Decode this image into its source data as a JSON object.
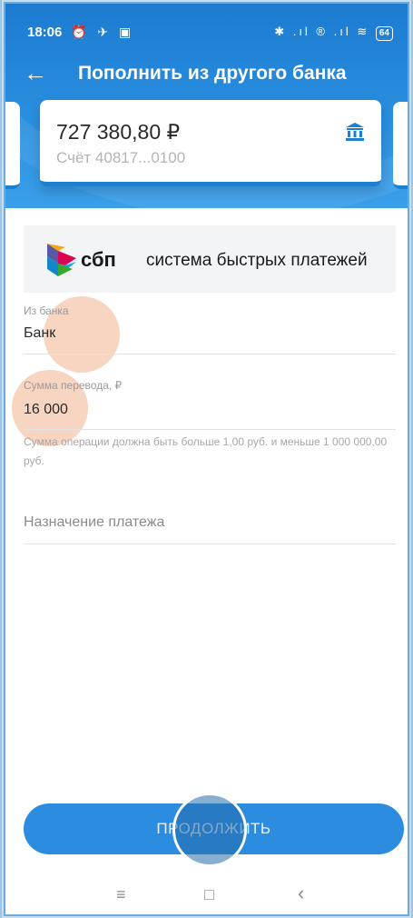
{
  "status_bar": {
    "time": "18:06",
    "left_icons": "⏰ ✈ ▣",
    "right_icons": "✱ .ıl ® .ıl ≋",
    "battery": "64"
  },
  "header": {
    "title": "Пополнить из другого банка"
  },
  "account": {
    "balance": "727 380,80 ₽",
    "number": "Счёт 40817...0100"
  },
  "sbp": {
    "short": "сбп",
    "long": "система быстрых платежей"
  },
  "form": {
    "bank_label": "Из банка",
    "bank_value": "Банк",
    "amount_label": "Сумма перевода, ₽",
    "amount_value": "16 000",
    "amount_hint": "Сумма операции должна быть больше 1,00 руб. и меньше 1 000 000,00 руб.",
    "purpose_placeholder": "Назначение платежа"
  },
  "actions": {
    "continue_label": "ПРОДОЛЖИТЬ"
  },
  "nav": {
    "menu": "≡",
    "home": "□",
    "back": "‹"
  },
  "colors": {
    "primary": "#2b8ce0",
    "header_dark": "#1c7bd0",
    "tap_marker": "#f3b28c"
  }
}
